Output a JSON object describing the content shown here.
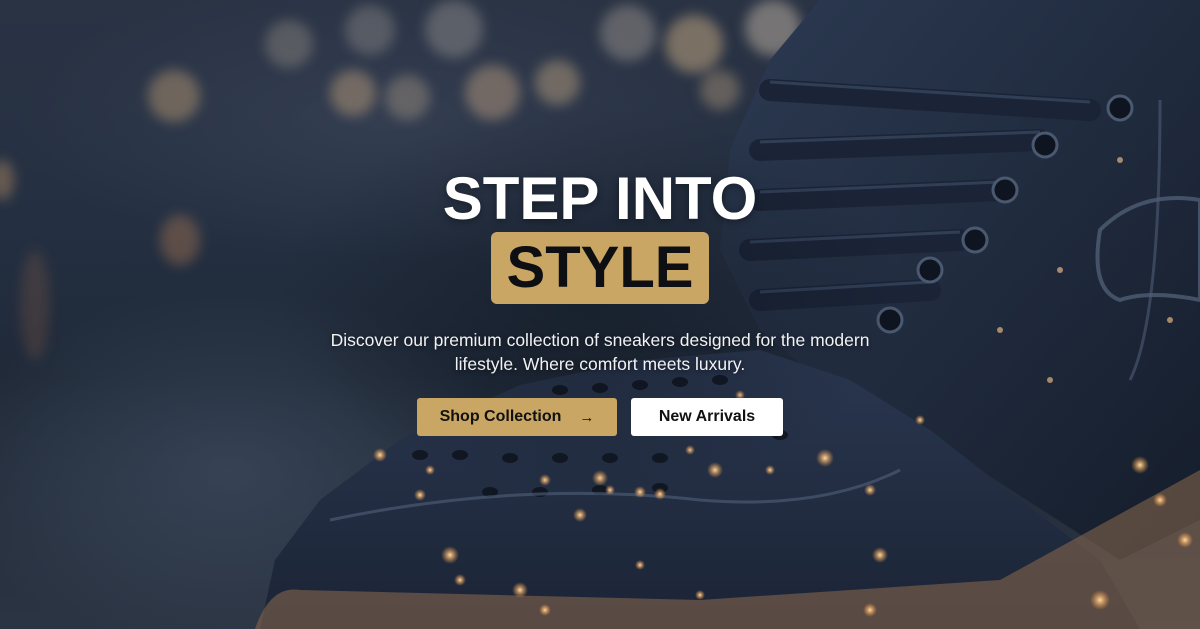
{
  "hero": {
    "title_line1": "STEP INTO",
    "title_highlight": "STYLE",
    "subtitle": "Discover our premium collection of sneakers designed for the modern lifestyle. Where comfort meets luxury.",
    "primary_button": {
      "label": "Shop Collection",
      "icon": "arrow-right-icon"
    },
    "secondary_button": {
      "label": "New Arrivals"
    }
  },
  "colors": {
    "accent_gold": "#c9a663",
    "title_text": "#ffffff",
    "highlight_text": "#0d0f12",
    "secondary_button_bg": "#ffffff"
  }
}
